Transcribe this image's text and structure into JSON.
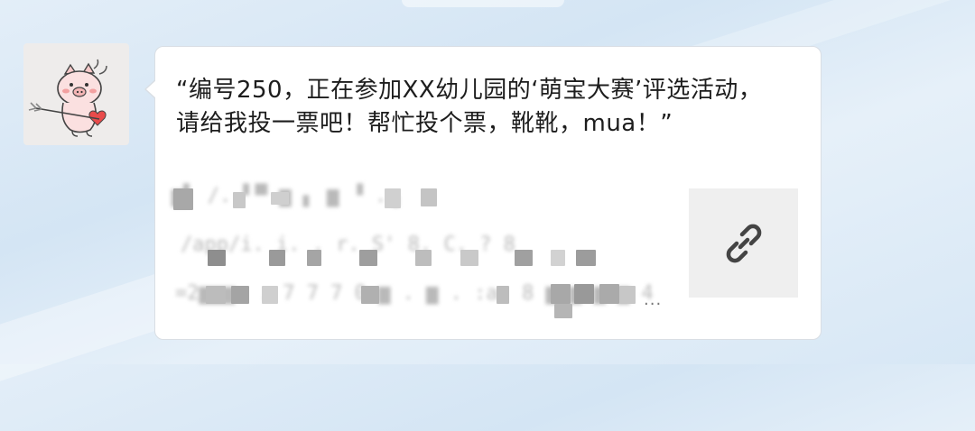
{
  "message": {
    "title": "“编号250，正在参加XX幼儿园的‘萌宝大赛’评选活动，请给我投一票吧！帮忙投个票，靴靴，mua！”",
    "description_obscured": {
      "line1": "▆▌ /. ▘▀  ▆ ▖ ▆  ▝ .▗",
      "line2": "/app/i. i. . r. S' 8. C. ? 8",
      "line3": "=2▆▆▆. . 7 7 7 0 ▆ . ▆ . :a. 8 ▆ ▆ ▆ ▆ 4",
      "ellipsis": "..."
    },
    "link_icon": "link-icon",
    "avatar_icon": "pig-cupid-avatar-icon"
  },
  "colors": {
    "background": "#dce9f6",
    "bubble": "#ffffff",
    "text": "#1d1d1d",
    "thumb": "#efefef",
    "link_icon": "#444444"
  }
}
